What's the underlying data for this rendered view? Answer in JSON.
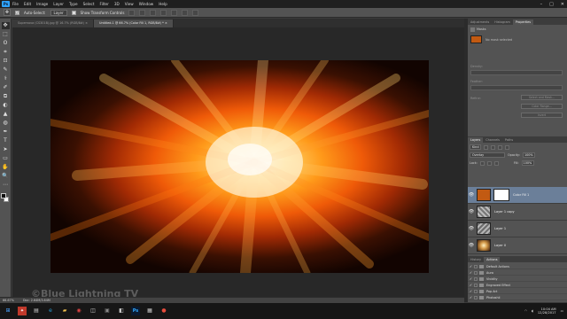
{
  "menu": {
    "logo": "Ps",
    "items": [
      "File",
      "Edit",
      "Image",
      "Layer",
      "Type",
      "Select",
      "Filter",
      "3D",
      "View",
      "Window",
      "Help"
    ]
  },
  "window_controls": {
    "minimize": "–",
    "maximize": "□",
    "close": "✕"
  },
  "options": {
    "auto_select_label": "Auto-Select:",
    "auto_select_target": "Layer",
    "show_transform_label": "Show Transform Controls"
  },
  "tabs": [
    {
      "label": "Supernova (CS301B).jpg @ 16.7% (RGB/8#) ×",
      "active": false
    },
    {
      "label": "Untitled-1 @ 66.7% (Color Fill 1, RGB/8#) * ×",
      "active": true
    }
  ],
  "tools": [
    "✥",
    "⬚",
    "ʘ",
    "⌗",
    "⊡",
    "✎",
    "⚕",
    "✐",
    "⧉",
    "◐",
    "▲",
    "◍",
    "✒",
    "T",
    "➤",
    "▭",
    "✋",
    "🔍",
    "⋯"
  ],
  "status": {
    "zoom": "66.67%",
    "doc": "Doc: 2.64M/3.64M"
  },
  "watermark": "©Blue Lightning TV",
  "panels": {
    "top_tabs": [
      "Adjustments",
      "Histogram",
      "Properties"
    ],
    "properties": {
      "section_label": "Masks",
      "mask_label": "No mask selected",
      "density_label": "Density:",
      "feather_label": "Feather:",
      "refine_label": "Refine:",
      "btn_select_mask": "Select and Mask...",
      "btn_color_range": "Color Range...",
      "btn_invert": "Invert"
    },
    "layers_tabs": [
      "Layers",
      "Channels",
      "Paths"
    ],
    "layers": {
      "kind": "Kind",
      "blend": "Overlay",
      "opacity_label": "Opacity:",
      "opacity": "100%",
      "lock_label": "Lock:",
      "fill_label": "Fill:",
      "fill": "100%",
      "items": [
        {
          "name": "Color Fill 1",
          "selected": true
        },
        {
          "name": "Layer 1 copy",
          "selected": false
        },
        {
          "name": "Layer 1",
          "selected": false
        },
        {
          "name": "Layer 0",
          "selected": false
        }
      ]
    },
    "actions_tabs": [
      "History",
      "Actions"
    ],
    "actions": [
      "Default Actions",
      "Aura",
      "Vividity",
      "Engraved Effect",
      "Pop Art",
      "Photoshii"
    ]
  },
  "clock": {
    "time": "10:04 AM",
    "date": "12/28/2017"
  },
  "colors": {
    "accent": "#2fa3ff",
    "selected_layer": "#6b7f99",
    "fill_swatch": "#c25a12"
  }
}
